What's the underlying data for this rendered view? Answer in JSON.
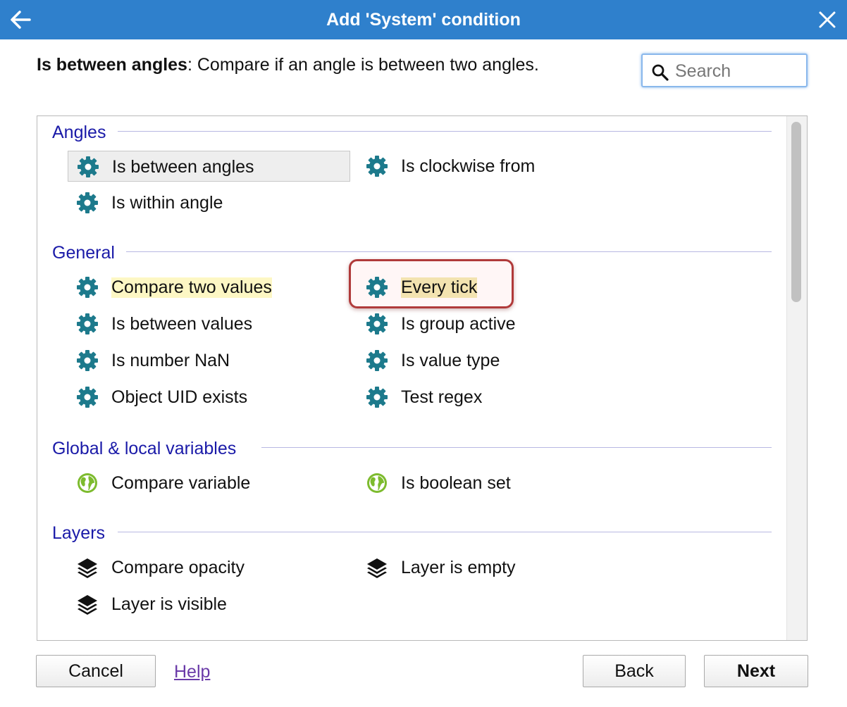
{
  "window": {
    "title": "Add 'System' condition"
  },
  "description": {
    "name": "Is between angles",
    "text": ": Compare if an angle is between two angles."
  },
  "search": {
    "placeholder": "Search"
  },
  "categories": [
    {
      "label": "Angles",
      "items": [
        {
          "label": "Is between angles",
          "icon": "gear-icon"
        },
        {
          "label": "Is clockwise from",
          "icon": "gear-icon"
        },
        {
          "label": "Is within angle",
          "icon": "gear-icon"
        }
      ]
    },
    {
      "label": "General",
      "items": [
        {
          "label": "Compare two values",
          "icon": "gear-icon"
        },
        {
          "label": "Every tick",
          "icon": "gear-icon"
        },
        {
          "label": "Is between values",
          "icon": "gear-icon"
        },
        {
          "label": "Is group active",
          "icon": "gear-icon"
        },
        {
          "label": "Is number NaN",
          "icon": "gear-icon"
        },
        {
          "label": "Is value type",
          "icon": "gear-icon"
        },
        {
          "label": "Object UID exists",
          "icon": "gear-icon"
        },
        {
          "label": "Test regex",
          "icon": "gear-icon"
        }
      ]
    },
    {
      "label": "Global & local variables",
      "items": [
        {
          "label": "Compare variable",
          "icon": "globe-icon"
        },
        {
          "label": "Is boolean set",
          "icon": "globe-icon"
        }
      ]
    },
    {
      "label": "Layers",
      "items": [
        {
          "label": "Compare opacity",
          "icon": "layers-icon"
        },
        {
          "label": "Layer is empty",
          "icon": "layers-icon"
        },
        {
          "label": "Layer is visible",
          "icon": "layers-icon"
        }
      ]
    }
  ],
  "footer": {
    "cancel_label": "Cancel",
    "help_label": "Help",
    "back_label": "Back",
    "next_label": "Next"
  },
  "colors": {
    "titlebar": "#2f80cc",
    "category": "#1a1aa8",
    "gear": "#1d7a8c",
    "globe": "#7dbb2e",
    "annotation": "#b03a3a"
  }
}
